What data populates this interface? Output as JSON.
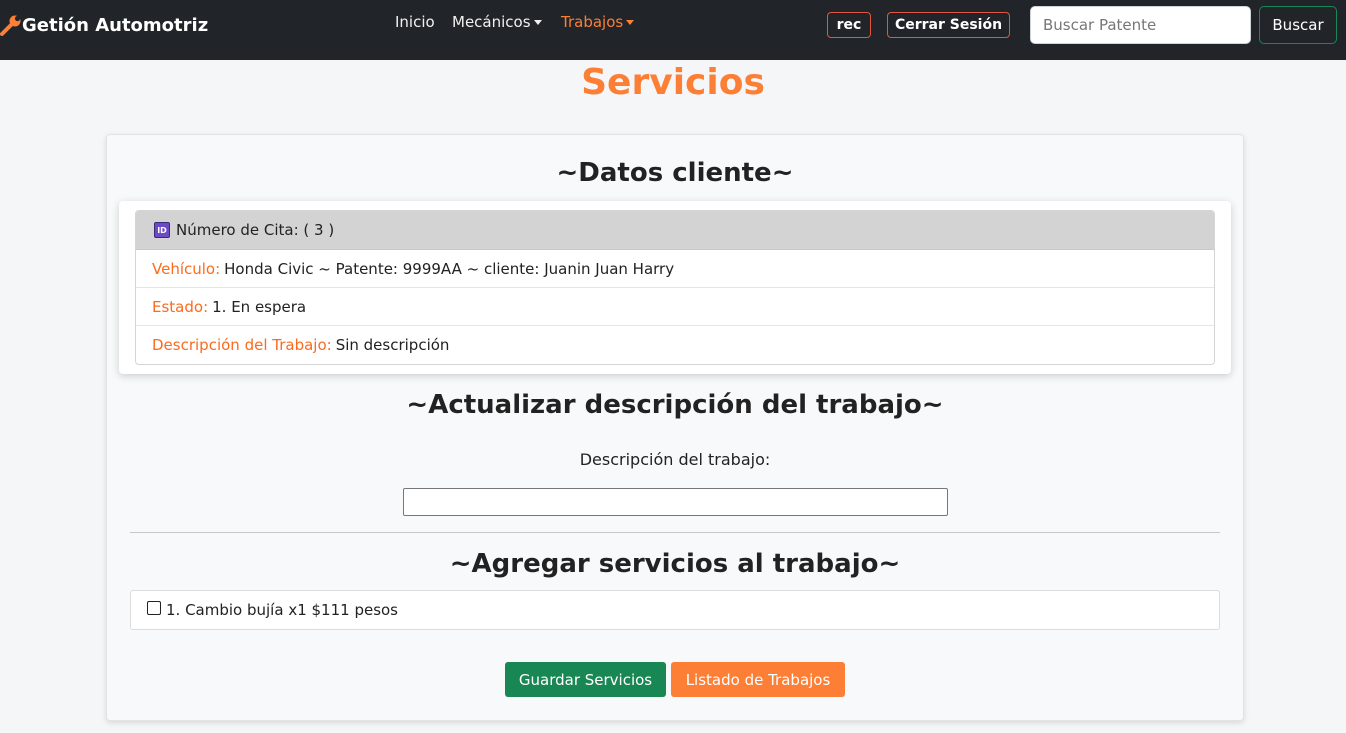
{
  "navbar": {
    "brand": "Getión Automotriz",
    "brand_icon": "wrench-icon",
    "links": {
      "inicio": "Inicio",
      "mecanicos": "Mecánicos",
      "trabajos": "Trabajos"
    },
    "user_button": "rec",
    "logout_button": "Cerrar Sesión",
    "search_placeholder": "Buscar Patente",
    "search_button": "Buscar"
  },
  "colors": {
    "accent": "#fd7e35",
    "navbar_bg": "#212529",
    "success": "#198754"
  },
  "page": {
    "title": "Servicios"
  },
  "client_section": {
    "title": "~Datos cliente~",
    "header_icon": "id-icon",
    "header": "Número de Cita: ( 3 )",
    "vehicle_label": "Vehículo:",
    "vehicle_value": "Honda Civic ~ Patente: 9999AA ~ cliente: Juanin Juan Harry",
    "status_label": "Estado:",
    "status_value": "1. En espera",
    "description_label": "Descripción del Trabajo:",
    "description_value": "Sin descripción"
  },
  "update_section": {
    "title": "~Actualizar descripción del trabajo~",
    "field_label": "Descripción del trabajo:",
    "field_value": ""
  },
  "services_section": {
    "title": "~Agregar servicios al trabajo~",
    "items": [
      {
        "label": "1. Cambio bujía x1 $111 pesos",
        "checked": false
      }
    ]
  },
  "actions": {
    "save": "Guardar Servicios",
    "list": "Listado de Trabajos"
  }
}
